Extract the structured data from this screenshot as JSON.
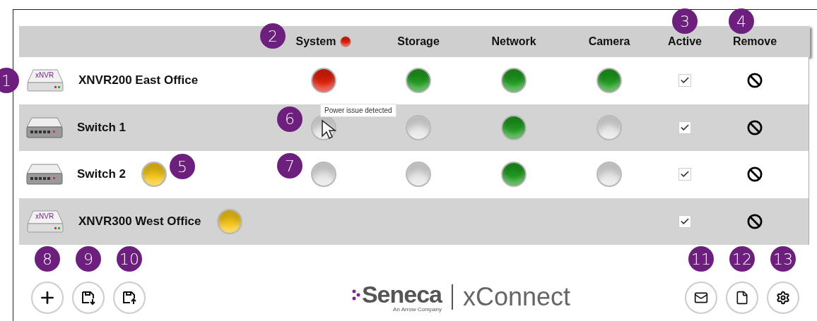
{
  "columns": [
    {
      "label": "System",
      "light": {
        "color": "#e0200a"
      },
      "callout": "2"
    },
    {
      "label": "Storage"
    },
    {
      "label": "Network"
    },
    {
      "label": "Camera"
    },
    {
      "label": "Active",
      "callout": "3"
    },
    {
      "label": "Remove",
      "callout": "4"
    }
  ],
  "devices": [
    {
      "kind": "nvr",
      "icon_label": "xNVR",
      "name": "XNVR200 East Office",
      "callout": "1",
      "lights": [
        {
          "color": "#e0200a"
        },
        {
          "color": "#1f9a1f"
        },
        {
          "color": "#1f9a1f"
        },
        {
          "color": "#1f9a1f"
        }
      ],
      "active": true
    },
    {
      "kind": "switch",
      "name": "Switch 1",
      "lights": [
        {
          "color": "#e6e6e6",
          "callout": "6",
          "tooltip": "Power issue detected"
        },
        {
          "color": "#e6e6e6"
        },
        {
          "color": "#1f9a1f"
        },
        {
          "color": "#e6e6e6"
        }
      ],
      "active": true
    },
    {
      "kind": "switch",
      "name": "Switch 2",
      "alert": {
        "color": "#f5c518",
        "callout": "5"
      },
      "lights": [
        {
          "color": "#e6e6e6",
          "callout": "7"
        },
        {
          "color": "#e6e6e6"
        },
        {
          "color": "#1f9a1f"
        },
        {
          "color": "#e6e6e6"
        }
      ],
      "active": true
    },
    {
      "kind": "nvr",
      "icon_label": "xNVR",
      "name": "XNVR300 West Office",
      "alert": {
        "color": "#f5c518"
      },
      "active": true
    }
  ],
  "left_buttons": [
    {
      "kind": "add",
      "callout": "8"
    },
    {
      "kind": "save-down",
      "callout": "9"
    },
    {
      "kind": "save-up",
      "callout": "10"
    }
  ],
  "logo": {
    "brand": "Seneca",
    "tagline": "An Arrow Company",
    "product": "xConnect"
  },
  "right_buttons": [
    {
      "kind": "mail",
      "callout": "11"
    },
    {
      "kind": "file",
      "callout": "12"
    },
    {
      "kind": "settings",
      "callout": "13"
    }
  ]
}
